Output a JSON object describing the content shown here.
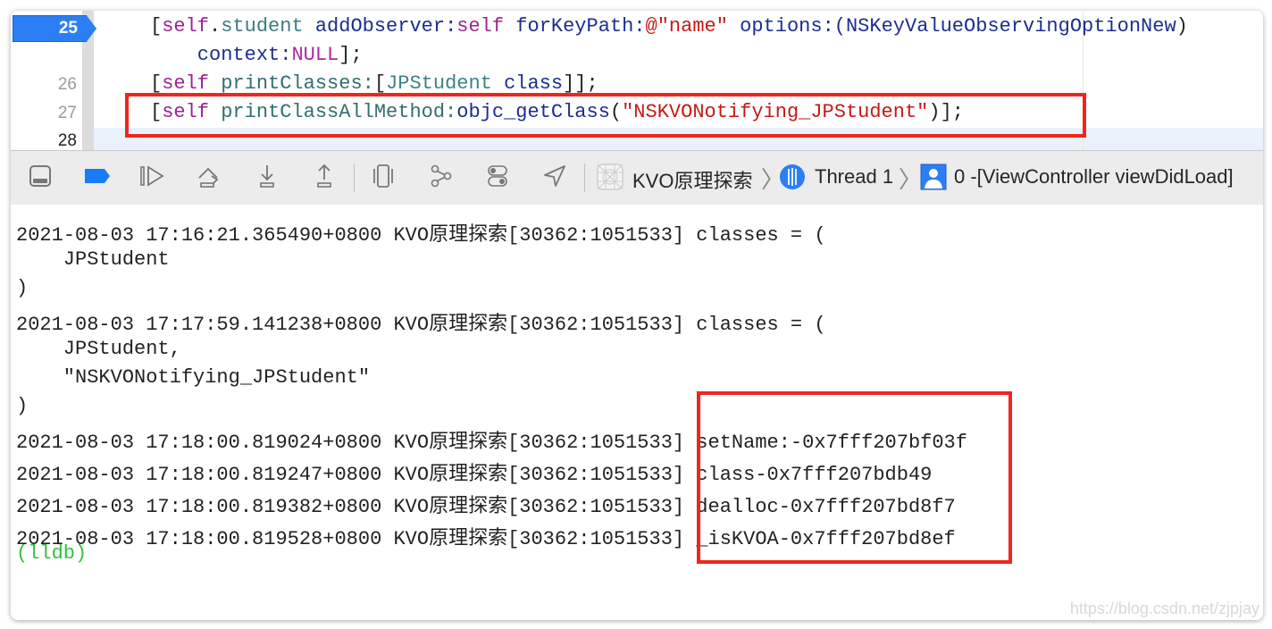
{
  "editor": {
    "breakpoint_line": "25",
    "lines": [
      {
        "num": "25",
        "tokens": [
          {
            "t": "[",
            "c": "p"
          },
          {
            "t": "self",
            "c": "self"
          },
          {
            "t": ".",
            "c": "p"
          },
          {
            "t": "student",
            "c": "prop"
          },
          {
            "t": " addObserver:",
            "c": "meth"
          },
          {
            "t": "self",
            "c": "self"
          },
          {
            "t": " forKeyPath:",
            "c": "meth"
          },
          {
            "t": "@\"name\"",
            "c": "str"
          },
          {
            "t": " options:(",
            "c": "meth"
          },
          {
            "t": "NSKeyValueObservingOptionNew",
            "c": "meth"
          },
          {
            "t": ")",
            "c": "p"
          }
        ]
      },
      {
        "num": "",
        "tokens": [
          {
            "t": "    context:",
            "c": "meth"
          },
          {
            "t": "NULL",
            "c": "null"
          },
          {
            "t": "];",
            "c": "p"
          }
        ]
      },
      {
        "num": "26",
        "tokens": [
          {
            "t": "[",
            "c": "p"
          },
          {
            "t": "self",
            "c": "self"
          },
          {
            "t": " printClasses:",
            "c": "fn"
          },
          {
            "t": "[",
            "c": "p"
          },
          {
            "t": "JPStudent",
            "c": "cls"
          },
          {
            "t": " class",
            "c": "meth"
          },
          {
            "t": "]];",
            "c": "p"
          }
        ]
      },
      {
        "num": "27",
        "tokens": [
          {
            "t": "[",
            "c": "p"
          },
          {
            "t": "self",
            "c": "self"
          },
          {
            "t": " printClassAllMethod:",
            "c": "fn"
          },
          {
            "t": "objc_getClass",
            "c": "meth"
          },
          {
            "t": "(",
            "c": "p"
          },
          {
            "t": "\"NSKVONotifying_JPStudent\"",
            "c": "str"
          },
          {
            "t": ")];",
            "c": "p"
          }
        ]
      },
      {
        "num": "28",
        "tokens": []
      }
    ]
  },
  "toolbar": {
    "icons": [
      "hide-debug-area-icon",
      "breakpoints-toggle-icon",
      "continue-icon",
      "step-over-icon",
      "step-into-icon",
      "step-out-icon",
      "view-hierarchy-icon",
      "memory-graph-icon",
      "environment-overrides-icon",
      "simulate-location-icon"
    ],
    "breadcrumb": {
      "app": "KVO原理探索",
      "thread": "Thread 1",
      "frame": "0 -[ViewController viewDidLoad]"
    }
  },
  "console": {
    "lines": [
      "2021-08-03 17:16:21.365490+0800 KVO原理探索[30362:1051533] classes = (",
      "    JPStudent",
      ")",
      "2021-08-03 17:17:59.141238+0800 KVO原理探索[30362:1051533] classes = (",
      "    JPStudent,",
      "    \"NSKVONotifying_JPStudent\"",
      ")",
      "2021-08-03 17:18:00.819024+0800 KVO原理探索[30362:1051533] setName:-0x7fff207bf03f",
      "2021-08-03 17:18:00.819247+0800 KVO原理探索[30362:1051533] class-0x7fff207bdb49",
      "2021-08-03 17:18:00.819382+0800 KVO原理探索[30362:1051533] dealloc-0x7fff207bd8f7",
      "2021-08-03 17:18:00.819528+0800 KVO原理探索[30362:1051533] _isKVOA-0x7fff207bd8ef"
    ],
    "prompt": "(lldb)"
  },
  "colors": {
    "highlight_box": "#f0261e",
    "breakpoint": "#2c7ef4",
    "lldb_prompt": "#30c13b"
  },
  "watermark": "https://blog.csdn.net/zjpjay"
}
